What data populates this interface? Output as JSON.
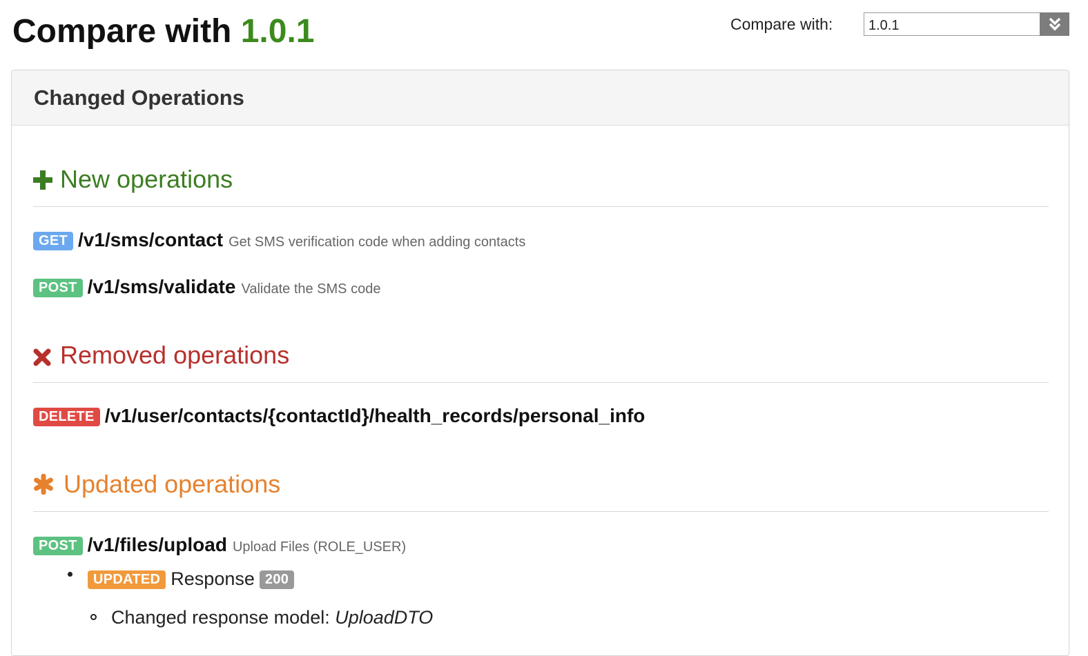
{
  "header": {
    "title_prefix": "Compare with",
    "title_version": "1.0.1",
    "compare_label": "Compare with:",
    "compare_selected": "1.0.1"
  },
  "panel": {
    "title": "Changed Operations"
  },
  "sections": {
    "new": {
      "title": "New operations",
      "icon": "plus-icon",
      "color": "#3c7d22",
      "ops": [
        {
          "method": "GET",
          "path": "/v1/sms/contact",
          "desc": "Get SMS verification code when adding contacts"
        },
        {
          "method": "POST",
          "path": "/v1/sms/validate",
          "desc": "Validate the SMS code"
        }
      ]
    },
    "removed": {
      "title": "Removed operations",
      "icon": "cross-icon",
      "color": "#b7302c",
      "ops": [
        {
          "method": "DELETE",
          "path": "/v1/user/contacts/{contactId}/health_records/personal_info"
        }
      ]
    },
    "updated": {
      "title": "Updated operations",
      "icon": "asterisk-icon",
      "color": "#e6812e",
      "ops": [
        {
          "method": "POST",
          "path": "/v1/files/upload",
          "desc": "Upload Files (ROLE_USER)",
          "change": {
            "badge": "UPDATED",
            "label": "Response",
            "code": "200",
            "detail_prefix": "Changed response model:",
            "detail_model": "UploadDTO"
          }
        }
      ]
    }
  },
  "colors": {
    "get": "#6ba8ef",
    "post": "#5cc181",
    "delete": "#e04a44",
    "updated": "#f19a3c",
    "version_green": "#3c8a1e"
  }
}
